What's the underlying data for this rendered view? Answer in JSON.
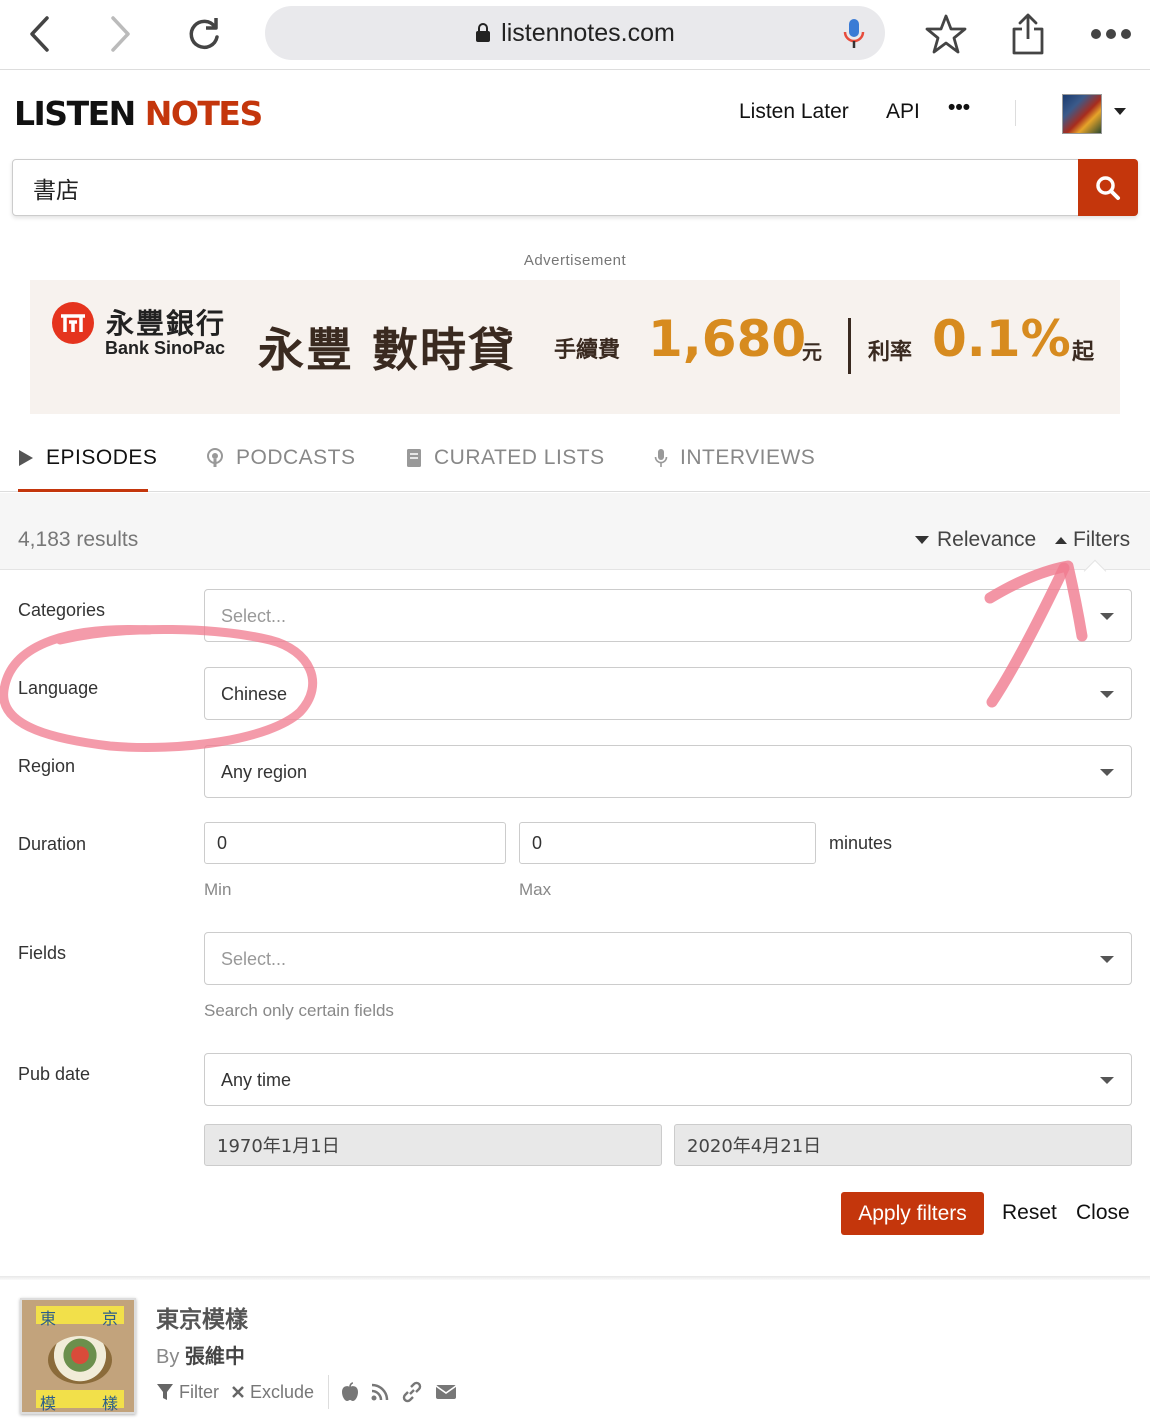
{
  "browser": {
    "url": "listennotes.com"
  },
  "header": {
    "logo_part1": "LISTEN ",
    "logo_part2": "NOTES",
    "listen_later": "Listen Later",
    "api": "API",
    "more": "•••"
  },
  "search": {
    "value": "書店"
  },
  "ad": {
    "label": "Advertisement",
    "bank_zh": "永豐銀行",
    "bank_en": "Bank SinoPac",
    "headline": "永豐 數時貸",
    "fee_label": "手續費",
    "fee_value": "1,680",
    "fee_unit": "元",
    "rate_label": "利率",
    "rate_value": "0.1%",
    "rate_unit": "起"
  },
  "tabs": [
    {
      "label": "EPISODES",
      "active": true
    },
    {
      "label": "PODCASTS",
      "active": false
    },
    {
      "label": "CURATED LISTS",
      "active": false
    },
    {
      "label": "INTERVIEWS",
      "active": false
    }
  ],
  "results": {
    "count": "4,183 results",
    "sort": "Relevance",
    "filters": "Filters"
  },
  "filters": {
    "categories": {
      "label": "Categories",
      "placeholder": "Select..."
    },
    "language": {
      "label": "Language",
      "value": "Chinese"
    },
    "region": {
      "label": "Region",
      "value": "Any region"
    },
    "duration": {
      "label": "Duration",
      "min": "0",
      "max": "0",
      "unit": "minutes",
      "min_hint": "Min",
      "max_hint": "Max"
    },
    "fields": {
      "label": "Fields",
      "placeholder": "Select...",
      "hint": "Search only certain fields"
    },
    "pub_date": {
      "label": "Pub date",
      "value": "Any time",
      "from": "1970年1月1日",
      "to": "2020年4月21日"
    },
    "apply": "Apply filters",
    "reset": "Reset",
    "close": "Close"
  },
  "result_item": {
    "title": "東京模樣",
    "by_prefix": "By",
    "author": "張維中",
    "filter": "Filter",
    "exclude": "Exclude",
    "thumb_glyphs": [
      "東",
      "京",
      "模",
      "樣"
    ]
  },
  "colors": {
    "brand": "#c4360c",
    "annotation": "#f07a8e"
  }
}
